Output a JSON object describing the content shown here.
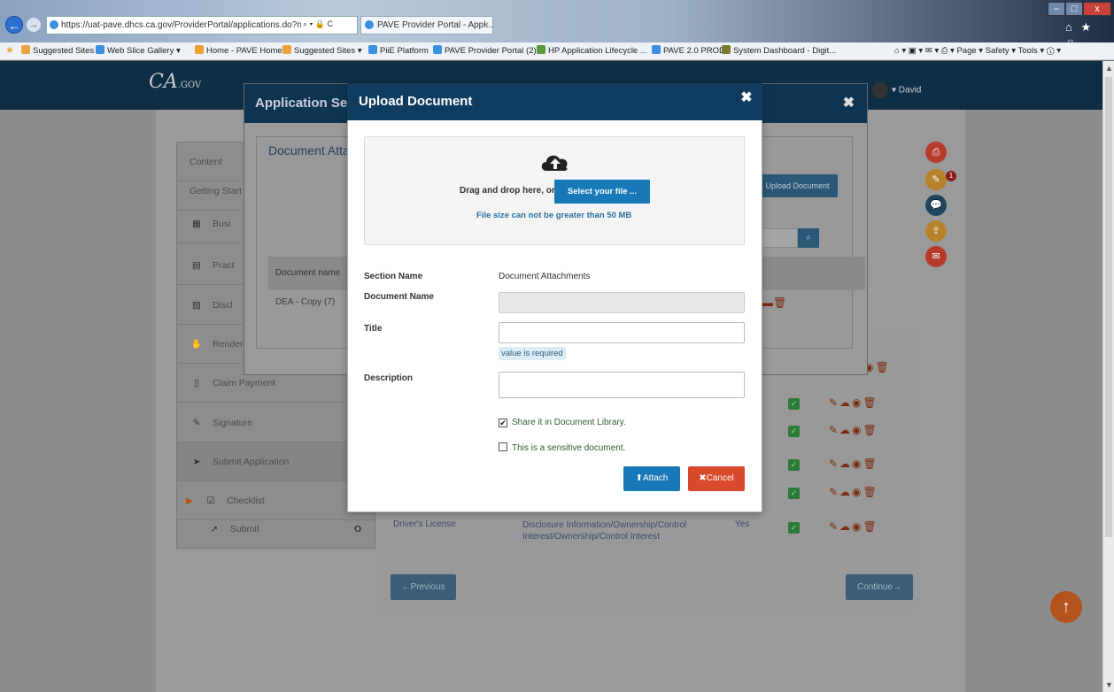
{
  "browser": {
    "back": "←",
    "forward": "→",
    "url": "https://uat-pave.dhcs.ca.gov/ProviderPortal/applications.do?nth=he8",
    "url_controls": "⌕ ▾ 🔒 C",
    "tab_title": "PAVE Provider Portal - Appl...",
    "tab_close": "×",
    "window_min": "–",
    "window_max": "□",
    "window_close": "x",
    "top_right_icons": "⌂ ★ ☼",
    "favorites": [
      {
        "label": "Suggested Sites ▾",
        "color": "#e8a33d"
      },
      {
        "label": "Web Slice Gallery ▾",
        "color": "#3b8fe0"
      },
      {
        "label": "Home - PAVE Home",
        "color": "#f0a030"
      },
      {
        "label": "Suggested Sites ▾",
        "color": "#e8a33d"
      },
      {
        "label": "PiiE Platform",
        "color": "#3b8fe0"
      },
      {
        "label": "PAVE Provider Portal (2)",
        "color": "#3b8fe0"
      },
      {
        "label": "HP Application Lifecycle ...",
        "color": "#5a9a3a"
      },
      {
        "label": "PAVE 2.0 PROD",
        "color": "#3b8fe0"
      },
      {
        "label": "System Dashboard - Digit...",
        "color": "#7a7a2a"
      }
    ],
    "command_bar": "⌂ ▾  ▣ ▾  ✉ ▾  ⎙ ▾  Page ▾  Safety ▾  Tools ▾  ⓘ ▾"
  },
  "site": {
    "logo": "CA",
    "logo_small": ".GOV",
    "user": "▾ David"
  },
  "left_nav": [
    {
      "label": "Content",
      "icon": ""
    },
    {
      "label": "Getting Start",
      "icon": ""
    },
    {
      "label": "Busi",
      "icon": "▦"
    },
    {
      "label": "Pract",
      "icon": "▤"
    },
    {
      "label": "Discl",
      "icon": "▧"
    },
    {
      "label": "Renderi",
      "icon": "✋"
    },
    {
      "label": "Claim Payment",
      "icon": "▯"
    },
    {
      "label": "Signature",
      "icon": "✎"
    },
    {
      "label": "Submit Application",
      "icon": "➤"
    },
    {
      "label": "Checklist",
      "icon": "☑"
    },
    {
      "label": "Submit",
      "icon": "➚"
    }
  ],
  "table_rows": [
    {
      "doc": "",
      "section": "",
      "req": ""
    },
    {
      "doc": "",
      "section": "",
      "req": ""
    },
    {
      "doc": "",
      "section": "",
      "req": ""
    },
    {
      "doc": "",
      "section": "",
      "req": ""
    },
    {
      "doc": "Driver's License",
      "section": "Disclosure Information/Ownership/Control Interest/Ownership/Control Interest",
      "req": "Yes"
    }
  ],
  "check_glyph": "✓",
  "action_glyphs": "✎☁◉🗑",
  "nav_buttons": {
    "previous": "←Previous",
    "continue": "Continue→"
  },
  "scroll_top": "↑",
  "badge_count": "1",
  "side_icons": [
    {
      "name": "pdf-icon",
      "glyph": "⎙",
      "color": "#b83a2c"
    },
    {
      "name": "notes-icon",
      "glyph": "✎",
      "color": "#b5842a"
    },
    {
      "name": "chat-icon",
      "glyph": "💬",
      "color": "#1f4660"
    },
    {
      "name": "share-icon",
      "glyph": "⇪",
      "color": "#b5842a"
    },
    {
      "name": "mail-icon",
      "glyph": "✉",
      "color": "#b83a2c"
    }
  ],
  "modal_back": {
    "title": "Application Sec",
    "close": "✖",
    "panel_title": "Document Atta",
    "upload_button": "Upload Document",
    "table_header": "Document name",
    "row_doc": "DEA - Copy (7)",
    "search_glyph": "⌕"
  },
  "upload_modal": {
    "title": "Upload Document",
    "close": "✖",
    "drag_label": "Drag and drop here, or",
    "select_button": "Select your file ...",
    "size_note": "File size can not be greater than 50 MB",
    "section_name_label": "Section Name",
    "section_name_value": "Document Attachments",
    "document_name_label": "Document Name",
    "document_name_value": "",
    "title_label": "Title",
    "title_value": "",
    "title_error": "value is required",
    "description_label": "Description",
    "description_value": "",
    "share_label": "Share it in Document Library.",
    "share_checked": true,
    "sensitive_label": "This is a sensitive document.",
    "sensitive_checked": false,
    "attach_button": "Attach",
    "attach_glyph": "⬆",
    "cancel_button": "Cancel",
    "cancel_glyph": "✖"
  }
}
